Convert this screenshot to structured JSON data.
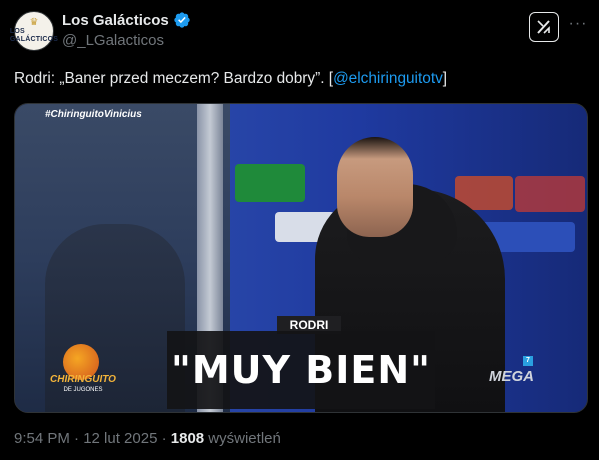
{
  "author": {
    "name": "Los Galácticos",
    "handle": "@_LGalacticos",
    "avatar_text": "LOS GALÁCTICOS",
    "verified": true
  },
  "tweet": {
    "text_before": "Rodri: „Baner przed meczem? Bardzo dobry”. [",
    "mention": "@elchiringuitotv",
    "text_after": "]"
  },
  "media": {
    "hashtag": "#ChiringuitoVinicius",
    "nameplate": "RODRI",
    "caption": "\"MUY BIEN\"",
    "left_logo": "CHIRINGUITO",
    "left_logo_sub": "DE JUGONES",
    "right_logo": "MEGA",
    "right_logo_num": "7"
  },
  "footer": {
    "time": "9:54 PM · 12 lut 2025 · ",
    "views_count": "1808",
    "views_label": " wyświetleń"
  },
  "icons": {
    "verified": "verified-badge-icon",
    "grok": "grok-icon",
    "more": "more-icon"
  },
  "colors": {
    "background": "#000000",
    "text": "#e7e9ea",
    "muted": "#71767b",
    "link": "#1d9bf0"
  }
}
